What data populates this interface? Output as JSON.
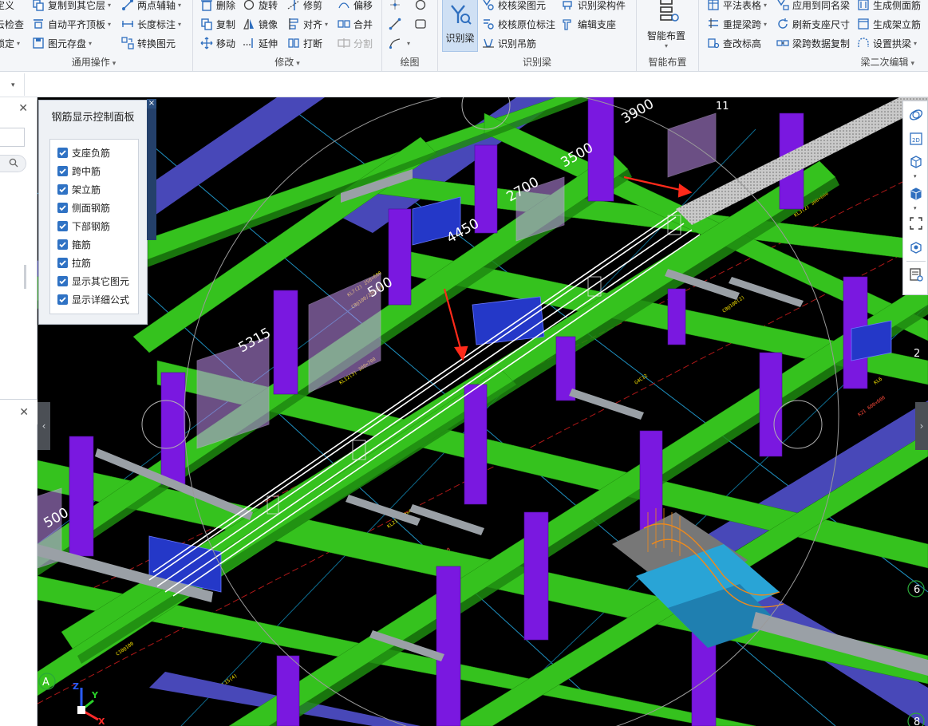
{
  "ribbon": {
    "general_ops": {
      "title": "通用操作",
      "items": [
        {
          "label": "定义",
          "icon": "define-icon"
        },
        {
          "label": "云检查",
          "icon": "cloud-check-icon"
        },
        {
          "label": "锁定",
          "icon": "lock-icon"
        },
        {
          "label": "复制到其它层",
          "icon": "copy-to-floor-icon"
        },
        {
          "label": "自动平齐顶板",
          "icon": "align-top-icon"
        },
        {
          "label": "图元存盘",
          "icon": "save-element-icon"
        },
        {
          "label": "两点辅轴",
          "icon": "two-point-axis-icon"
        },
        {
          "label": "长度标注",
          "icon": "length-dimension-icon"
        },
        {
          "label": "转换图元",
          "icon": "convert-element-icon"
        }
      ]
    },
    "modify": {
      "title": "修改",
      "items": [
        {
          "label": "删除",
          "icon": "delete-icon"
        },
        {
          "label": "复制",
          "icon": "copy-icon"
        },
        {
          "label": "移动",
          "icon": "move-icon"
        },
        {
          "label": "旋转",
          "icon": "rotate-icon"
        },
        {
          "label": "镜像",
          "icon": "mirror-icon"
        },
        {
          "label": "延伸",
          "icon": "extend-icon"
        },
        {
          "label": "修剪",
          "icon": "trim-icon"
        },
        {
          "label": "对齐",
          "icon": "align-icon"
        },
        {
          "label": "打断",
          "icon": "break-icon"
        },
        {
          "label": "偏移",
          "icon": "offset-icon"
        },
        {
          "label": "合并",
          "icon": "merge-icon"
        },
        {
          "label": "分割",
          "icon": "split-icon"
        }
      ]
    },
    "draw": {
      "title": "绘图"
    },
    "identify_beam": {
      "title": "识别梁",
      "big_button": "识别梁",
      "items": [
        {
          "label": "校核梁图元",
          "icon": "check-beam-icon"
        },
        {
          "label": "校核原位标注",
          "icon": "check-annotation-icon"
        },
        {
          "label": "识别吊筋",
          "icon": "identify-hanger-icon"
        },
        {
          "label": "识别梁构件",
          "icon": "identify-beam-component-icon"
        },
        {
          "label": "编辑支座",
          "icon": "edit-support-icon"
        }
      ]
    },
    "smart_layout": {
      "title": "智能布置",
      "big_button": "智能布置"
    },
    "beam_edit": {
      "title": "梁二次编辑",
      "items": [
        {
          "label": "平法表格",
          "icon": "table-icon"
        },
        {
          "label": "重提梁跨",
          "icon": "respan-icon"
        },
        {
          "label": "查改标高",
          "icon": "elevation-icon"
        },
        {
          "label": "应用到同名梁",
          "icon": "apply-same-icon"
        },
        {
          "label": "刷新支座尺寸",
          "icon": "refresh-support-icon"
        },
        {
          "label": "梁跨数据复制",
          "icon": "span-copy-icon"
        },
        {
          "label": "生成侧面筋",
          "icon": "side-rebar-icon"
        },
        {
          "label": "生成架立筋",
          "icon": "erect-rebar-icon"
        },
        {
          "label": "设置拱梁",
          "icon": "arch-beam-icon"
        }
      ]
    }
  },
  "control_panel": {
    "title": "钢筋显示控制面板",
    "options": [
      {
        "label": "支座负筋",
        "checked": true
      },
      {
        "label": "跨中筋",
        "checked": true
      },
      {
        "label": "架立筋",
        "checked": true
      },
      {
        "label": "侧面钢筋",
        "checked": true
      },
      {
        "label": "下部钢筋",
        "checked": true
      },
      {
        "label": "箍筋",
        "checked": true
      },
      {
        "label": "拉筋",
        "checked": true
      },
      {
        "label": "显示其它图元",
        "checked": true
      },
      {
        "label": "显示详细公式",
        "checked": true
      }
    ]
  },
  "scene": {
    "dims": [
      "3900",
      "3500",
      "2700",
      "4450",
      "5315",
      "500",
      "500"
    ],
    "axis_labels": [
      "11",
      "A",
      "6",
      "8",
      "2"
    ],
    "axes": {
      "x": "X",
      "y": "Y",
      "z": "Z"
    },
    "colors": {
      "beam": "#35c21e",
      "column": "#7a18e0",
      "slab_edge": "#4848b8",
      "rebar": "#ffffff",
      "annotation": "#f5e100",
      "marker": "#ff2a1a",
      "background": "#000000"
    }
  },
  "right_toolbar": [
    "orbit-icon",
    "2d-view-icon",
    "3d-box-icon",
    "3d-solid-icon",
    "fit-view-icon",
    "element-icon",
    "properties-icon"
  ]
}
